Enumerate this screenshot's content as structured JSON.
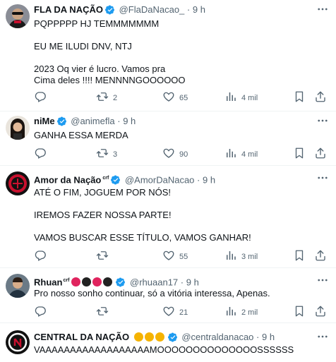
{
  "tweets": [
    {
      "name": "FLA DA NAÇÃO",
      "handle": "@FlaDaNacao_",
      "time": "9 h",
      "lines": [
        "PQPPPPP HJ TEMMMMMMM",
        "",
        "EU ME ILUDI DNV, NTJ",
        "",
        "2023 Oq vier é lucro. Vamos pra",
        "Cima deles !!!! MENNNNGOOOOOO"
      ],
      "replies": "",
      "retweets": "2",
      "likes": "65",
      "views": "4 mil"
    },
    {
      "name": "niMe",
      "handle": "@animefla",
      "time": "9 h",
      "lines": [
        "GANHA ESSA MERDA"
      ],
      "replies": "",
      "retweets": "3",
      "likes": "90",
      "views": "4 mil"
    },
    {
      "name": "Amor da Nação",
      "name_suffix": "crf",
      "handle": "@AmorDaNacao",
      "time": "9 h",
      "lines": [
        "ATÉ O FIM, JOGUEM POR NÓS!",
        "",
        "IREMOS FAZER NOSSA PARTE!",
        "",
        "VAMOS BUSCAR ESSE TÍTULO, VAMOS GANHAR!"
      ],
      "replies": "",
      "retweets": "",
      "likes": "55",
      "views": "3 mil"
    },
    {
      "name": "Rhuan",
      "name_suffix": "crf",
      "handle": "@rhuaan17",
      "time": "9 h",
      "lines": [
        "Pro nosso sonho continuar, só a vitória interessa, Apenas."
      ],
      "replies": "",
      "retweets": "",
      "likes": "21",
      "views": "2 mil"
    },
    {
      "name": "CENTRAL DA NAÇÃO",
      "handle": "@centraldanacao",
      "time": "9 h",
      "lines": [
        "VAAAAAAAAAAAAAAAAAAMOOOOOOOOOOOOOOSSSSSS"
      ]
    }
  ],
  "colors": {
    "verified": "#1d9bf0",
    "secondary_text": "#536471",
    "flamengo_red": "#c8102e"
  },
  "icons": {
    "verified": "verified-badge-icon",
    "more": "more-icon",
    "reply": "reply-icon",
    "retweet": "retweet-icon",
    "like": "like-icon",
    "views": "views-icon",
    "bookmark": "bookmark-icon",
    "share": "share-icon"
  }
}
